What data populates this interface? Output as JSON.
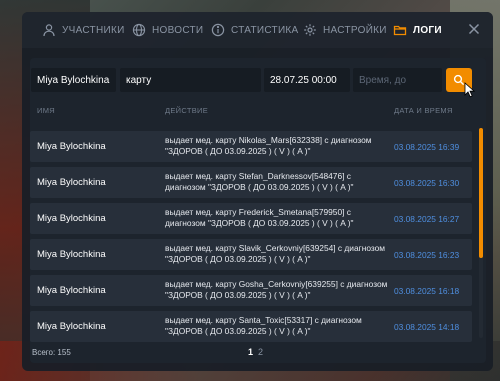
{
  "tabs": [
    {
      "label": "УЧАСТНИКИ",
      "icon": "user-icon",
      "active": false
    },
    {
      "label": "НОВОСТИ",
      "icon": "globe-icon",
      "active": false
    },
    {
      "label": "СТАТИСТИКА",
      "icon": "info-icon",
      "active": false
    },
    {
      "label": "НАСТРОЙКИ",
      "icon": "gear-icon",
      "active": false
    },
    {
      "label": "ЛОГИ",
      "icon": "folder-icon",
      "active": true
    }
  ],
  "filters": {
    "name_value": "Miya Bylochkina",
    "action_value": "карту",
    "date_from_value": "28.07.25 00:00",
    "date_to_placeholder": "Время, до"
  },
  "columns": {
    "name": "ИМЯ",
    "action": "ДЕЙСТВИЕ",
    "datetime": "ДАТА И ВРЕМЯ"
  },
  "rows": [
    {
      "name": "Miya Bylochkina",
      "action": "выдает мед. карту Nikolas_Mars[632338] с диагнозом \"ЗДОРОВ ( ДО 03.09.2025 ) ( V ) ( A )\"",
      "date": "03.08.2025 16:39"
    },
    {
      "name": "Miya Bylochkina",
      "action": "выдает мед. карту Stefan_Darknessov[548476] с диагнозом \"ЗДОРОВ ( ДО 03.09.2025 ) ( V ) ( A )\"",
      "date": "03.08.2025 16:30"
    },
    {
      "name": "Miya Bylochkina",
      "action": "выдает мед. карту Frederick_Smetana[579950] с диагнозом \"ЗДОРОВ ( ДО 03.09.2025 ) ( V ) ( A )\"",
      "date": "03.08.2025 16:27"
    },
    {
      "name": "Miya Bylochkina",
      "action": "выдает мед. карту Slavik_Cerkovniy[639254] с диагнозом \"ЗДОРОВ ( ДО 03.09.2025 ) ( V ) ( A )\"",
      "date": "03.08.2025 16:23"
    },
    {
      "name": "Miya Bylochkina",
      "action": "выдает мед. карту Gosha_Cerkovniy[639255] с диагнозом \"ЗДОРОВ ( ДО 03.09.2025 ) ( V ) ( A )\"",
      "date": "03.08.2025 16:18"
    },
    {
      "name": "Miya Bylochkina",
      "action": "выдает мед. карту Santa_Toxic[53317] с диагнозом \"ЗДОРОВ ( ДО 03.09.2025 ) ( V ) ( A )\"",
      "date": "03.08.2025 14:18"
    }
  ],
  "footer": {
    "total": "Всего: 155",
    "pages": [
      "1",
      "2"
    ],
    "current_page": "1"
  },
  "colors": {
    "accent": "#f28c00",
    "date_text": "#4f8fe0",
    "panel": "#181e26",
    "row": "#272f3a"
  }
}
